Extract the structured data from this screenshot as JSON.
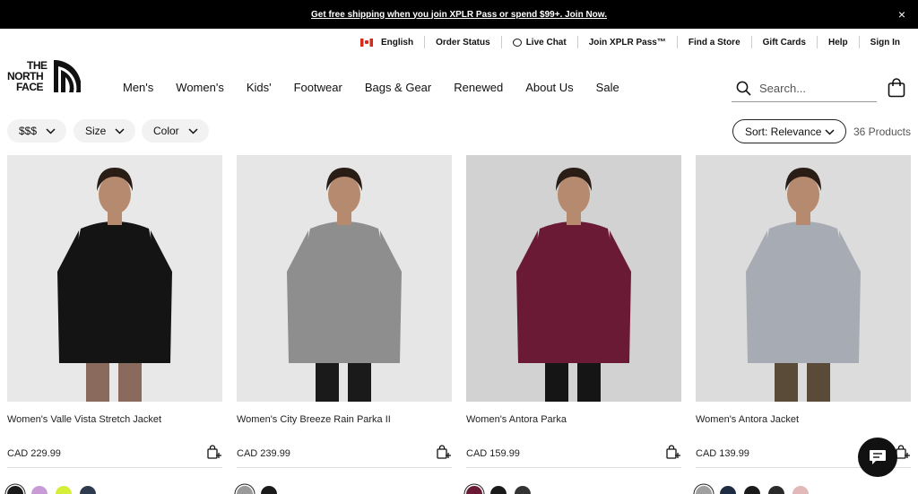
{
  "promo": {
    "text": "Get free shipping when you join XPLR Pass or spend $99+. Join Now.",
    "close": "×"
  },
  "utility": [
    "English",
    "Order Status",
    "Live Chat",
    "Join XPLR Pass™",
    "Find a Store",
    "Gift Cards",
    "Help",
    "Sign In"
  ],
  "brand": {
    "line1": "THE",
    "line2": "NORTH",
    "line3": "FACE"
  },
  "nav": [
    "Men's",
    "Women's",
    "Kids'",
    "Footwear",
    "Bags & Gear",
    "Renewed",
    "About Us",
    "Sale"
  ],
  "search": {
    "placeholder": "Search..."
  },
  "filters": [
    "$$$",
    "Size",
    "Color"
  ],
  "sort_label": "Sort: Relevance",
  "product_count": "36 Products",
  "products": [
    {
      "name": "Women's Valle Vista Stretch Jacket",
      "price": "CAD 229.99",
      "image": {
        "bg": "#e8e8e8",
        "jacket": "#141414",
        "pants": "#8a6a5c"
      },
      "swatches": [
        "#1a1a1a",
        "#c99bd6",
        "#d4ee3a",
        "#2e3a4e"
      ]
    },
    {
      "name": "Women's City Breeze Rain Parka II",
      "price": "CAD 239.99",
      "image": {
        "bg": "#e6e6e6",
        "jacket": "#8e8e8e",
        "pants": "#1a1a1a"
      },
      "swatches": [
        "#9a9a9a",
        "#1a1a1a"
      ]
    },
    {
      "name": "Women's Antora Parka",
      "price": "CAD 159.99",
      "image": {
        "bg": "#d2d2d2",
        "jacket": "#6b1a35",
        "pants": "#151515"
      },
      "swatches": [
        "#6b1a35",
        "#1a1a1a",
        "#333333"
      ]
    },
    {
      "name": "Women's Antora Jacket",
      "price": "CAD 139.99",
      "image": {
        "bg": "#dcdcdc",
        "jacket": "#a7abb4",
        "pants": "#5a4a38"
      },
      "swatches": [
        "#a0a0a0",
        "#1f2d44",
        "#1a1a1a",
        "#2a2a2a",
        "#e2b8b8"
      ]
    }
  ]
}
